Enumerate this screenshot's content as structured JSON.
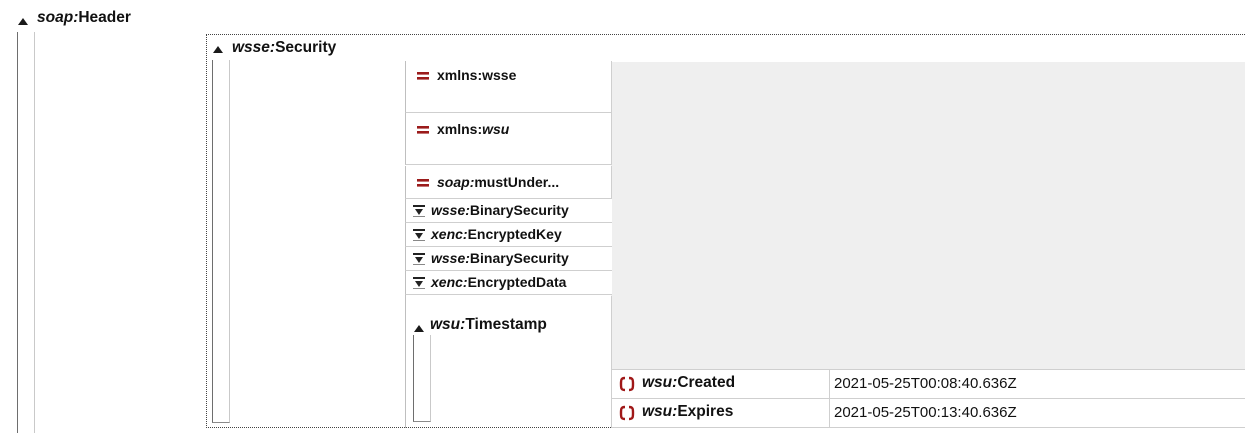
{
  "soap_header": {
    "prefix": "soap",
    "name": "Header"
  },
  "security": {
    "prefix": "wsse",
    "name": "Security"
  },
  "attributes": [
    {
      "prefix": "",
      "name": "xmlns:wsse"
    },
    {
      "prefix": "",
      "name": "xmlns:wsu"
    },
    {
      "prefix": "soap",
      "name": "mustUnder..."
    }
  ],
  "children": [
    {
      "prefix": "wsse",
      "name": "BinarySecurity"
    },
    {
      "prefix": "xenc",
      "name": "EncryptedKey"
    },
    {
      "prefix": "wsse",
      "name": "BinarySecurity"
    },
    {
      "prefix": "xenc",
      "name": "EncryptedData"
    }
  ],
  "timestamp": {
    "prefix": "wsu",
    "name": "Timestamp",
    "rows": [
      {
        "prefix": "wsu",
        "name": "Created",
        "value": "2021-05-25T00:08:40.636Z"
      },
      {
        "prefix": "wsu",
        "name": "Expires",
        "value": "2021-05-25T00:13:40.636Z"
      }
    ]
  },
  "colors": {
    "attr_icon": "#9b1b1b",
    "panel_bg": "#efefef"
  }
}
